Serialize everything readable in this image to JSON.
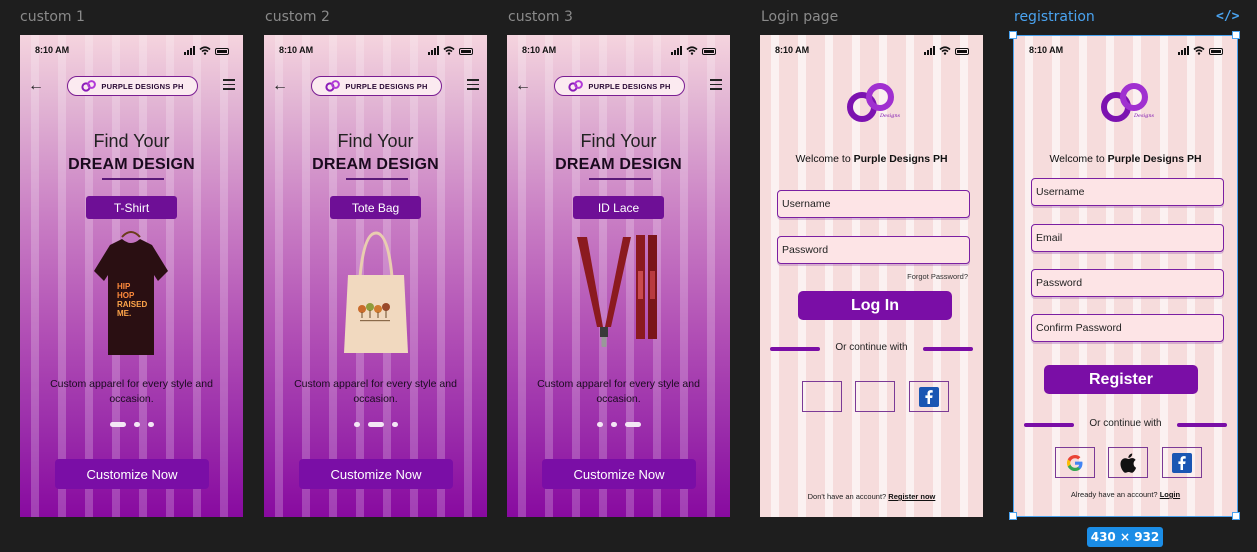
{
  "frames": [
    {
      "label": "custom 1"
    },
    {
      "label": "custom 2"
    },
    {
      "label": "custom 3"
    },
    {
      "label": "Login page"
    },
    {
      "label": "registration"
    }
  ],
  "status_time": "8:10 AM",
  "brand": "PURPLE DESIGNS PH",
  "hero": {
    "line1": "Find Your",
    "line2": "DREAM DESIGN"
  },
  "categories": [
    "T-Shirt",
    "Tote Bag",
    "ID Lace"
  ],
  "tshirt_print": [
    "HIP",
    "HOP",
    "RAISED",
    "ME."
  ],
  "description": "Custom apparel for every style and occasion.",
  "cta_label": "Customize Now",
  "login": {
    "welcome_prefix": "Welcome to ",
    "welcome_brand": "Purple Designs PH",
    "username_placeholder": "Username",
    "password_placeholder": "Password",
    "forgot": "Forgot Password?",
    "button": "Log In",
    "or_continue": "Or continue with",
    "footer_prefix": "Don't have an account? ",
    "footer_link": "Register now"
  },
  "registration": {
    "welcome_prefix": "Welcome to ",
    "welcome_brand": "Purple Designs PH",
    "username_placeholder": "Username",
    "email_placeholder": "Email",
    "password_placeholder": "Password",
    "confirm_placeholder": "Confirm Password",
    "button": "Register",
    "or_continue": "Or continue with",
    "footer_prefix": "Already have an account? ",
    "footer_link": "Login"
  },
  "dimension_badge": "430 × 932",
  "code_icon": "</>",
  "colors": {
    "brand_purple": "#7a0ea6",
    "selection_blue": "#4aa3f0",
    "canvas": "#1e1e1e"
  }
}
